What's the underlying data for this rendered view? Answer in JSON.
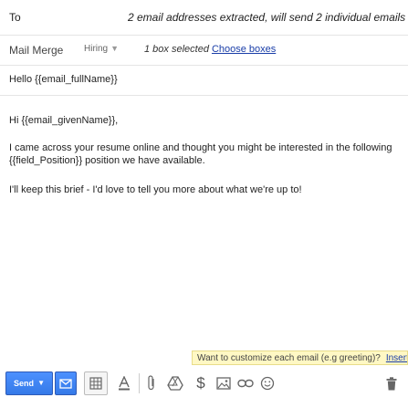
{
  "header": {
    "to_label": "To",
    "to_value": "2 email addresses extracted, will send 2 individual emails"
  },
  "mail_merge": {
    "label": "Mail Merge",
    "dropdown_value": "Hiring",
    "status_text": "1 box selected",
    "choose_link": "Choose boxes"
  },
  "subject": "Hello {{email_fullName}}",
  "body": {
    "greeting": "Hi {{email_givenName}},",
    "paragraph1": "I came across your resume online and thought you might be interested in the following {{field_Position}} position we have available.",
    "paragraph2": "I'll keep this brief - I'd love to tell you more about what we're up to!"
  },
  "tip": {
    "text": "Want to customize each email (e.g greeting)?",
    "link": "Insert Template"
  },
  "toolbar": {
    "send_label": "Send",
    "icons": [
      "merge-icon",
      "grid-icon",
      "format-text-icon",
      "attach-icon",
      "drive-icon",
      "money-icon",
      "photo-icon",
      "link-icon",
      "emoji-icon",
      "trash-icon"
    ]
  },
  "colors": {
    "accent": "#4d90fe",
    "link": "#1a3ea8",
    "tip_bg": "#fff8c4"
  }
}
